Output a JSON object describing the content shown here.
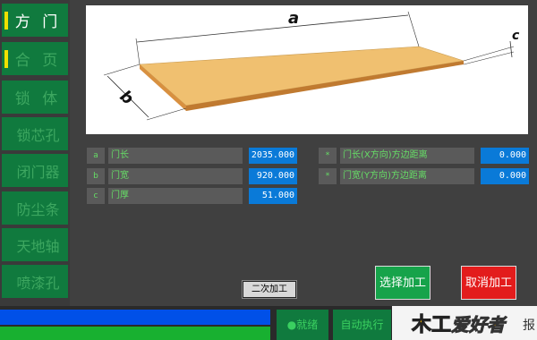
{
  "sidebar": {
    "items": [
      {
        "label": "方 门",
        "active": true
      },
      {
        "label": "合 页",
        "active": false
      },
      {
        "label": "锁 体",
        "active": false
      },
      {
        "label": "锁芯孔",
        "active": false
      },
      {
        "label": "闭门器",
        "active": false
      },
      {
        "label": "防尘条",
        "active": false
      },
      {
        "label": "天地轴",
        "active": false
      },
      {
        "label": "喷漆孔",
        "active": false
      }
    ]
  },
  "diagram": {
    "label_a": "a",
    "label_b": "b",
    "label_c": "c"
  },
  "params_left": [
    {
      "tag": "a",
      "label": "门长",
      "value": "2035.000"
    },
    {
      "tag": "b",
      "label": "门宽",
      "value": "920.000"
    },
    {
      "tag": "c",
      "label": "门厚",
      "value": "51.000"
    }
  ],
  "params_right": [
    {
      "tag": "*",
      "label": "门长(X方向)方边距离",
      "value": "0.000"
    },
    {
      "tag": "*",
      "label": "门宽(Y方向)方边距离",
      "value": "0.000"
    }
  ],
  "buttons": {
    "secondary": "二次加工",
    "select": "选择加工",
    "cancel": "取消加工"
  },
  "status": {
    "ready": "●就绪",
    "auto": "自动执行"
  },
  "logo": {
    "mark": "木工",
    "text": "爱好者",
    "tail": "报"
  },
  "colors": {
    "nav_green": "#107a3e",
    "value_blue": "#0a7ad8",
    "select_green": "#16a34a",
    "cancel_red": "#e31c1c",
    "board": "#f0c070"
  }
}
